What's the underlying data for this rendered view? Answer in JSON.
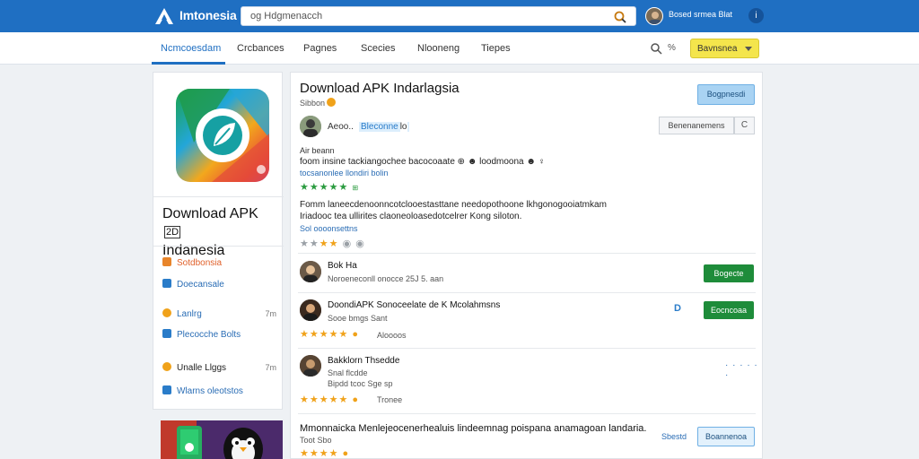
{
  "header": {
    "brand": "Imtonesia",
    "search_placeholder": "og Hdgmenacch",
    "user_name": "Bosed srmea  Blat",
    "info": "i"
  },
  "nav": {
    "tabs": [
      "Ncmcoesdam",
      "Crcbances",
      "Pagnes",
      "Scecies",
      "Nlooneng",
      "Tiepes"
    ],
    "pct": "%",
    "dropdown": "Bavnsnea"
  },
  "sidebar": {
    "app_title": "Download APK",
    "app_badge": "2D",
    "app_title2": "Indanesia",
    "items": [
      {
        "label": "Sotdbonsia",
        "value": "",
        "color": "#e8852b",
        "text_color": "#e0612b"
      },
      {
        "label": "Doecansale",
        "value": "",
        "color": "#2a7cc9",
        "text_color": "#2a6db5"
      },
      {
        "label": "Lanlrg",
        "value": "7m",
        "color": "#f0a21a",
        "text_color": "#2a6db5"
      },
      {
        "label": "Plecocche Bolts",
        "value": "",
        "color": "#2a7cc9",
        "text_color": "#2a6db5"
      },
      {
        "label": "Unalle Llggs",
        "value": "7m",
        "color": "#f0a21a",
        "text_color": "#222"
      },
      {
        "label": "Wlarns oleotstos",
        "value": "",
        "color": "#2a7cc9",
        "text_color": "#2a6db5"
      }
    ]
  },
  "main": {
    "title": "Download APK Indarlagsia",
    "subtitle": "Sibbon",
    "download_label": "Bogpnesdi",
    "author": {
      "name": "Aeoo..",
      "tag": "Bleconne",
      "tag2": "lo"
    },
    "segment_button": "Benenanemens",
    "refresh": "C",
    "desc_head": "Air beann",
    "desc_lines": [
      "foom insine tackiangochee bacocoaate  ⊕  ☻  loodmoona  ☻  ♀",
      "tocsanonlee llondiri  bolin"
    ],
    "review_text": "Fomm laneecdenoonncotclooestasttane needopothoone lkhgonogooiatmkam Iriadooc tea ullirites claoneoloasedotcelrer Kong siloton.",
    "review_link": "Sol oooonsettns",
    "reviews": [
      {
        "name": "Bok Ha",
        "meta": "Noroeneconll onocce  25J  5.  aan",
        "button": "Bogecte"
      },
      {
        "name": "DoondiAPK  Sonoceelate de K Mcolahmsns",
        "meta": "Sooe  bmgs  Sant",
        "button": "Eocncoaa",
        "pin": "D",
        "rating_label": "Aloooos"
      },
      {
        "name": "Bakklorn Thsedde",
        "meta": "Snal flcdde",
        "meta2": "Bipdd  tcoc  Sge  sp",
        "rating_label": "Tronee"
      },
      {
        "name": "Mmonnaicka Menlejeocenerhealuis lindeemnag poispana anamagoan landaria.",
        "meta": "Toot  Sbo",
        "button": "Boannenoa",
        "link": "Sbestd"
      }
    ]
  },
  "colors": {
    "header_blue": "#1f6fc2",
    "accent_green": "#1e8c3a",
    "accent_yellow": "#f4e54c"
  },
  "icons": [
    "logo-icon",
    "search-icon",
    "user-avatar",
    "info-icon",
    "chevron-down-icon",
    "star-icon",
    "coin-icon",
    "refresh-icon"
  ]
}
